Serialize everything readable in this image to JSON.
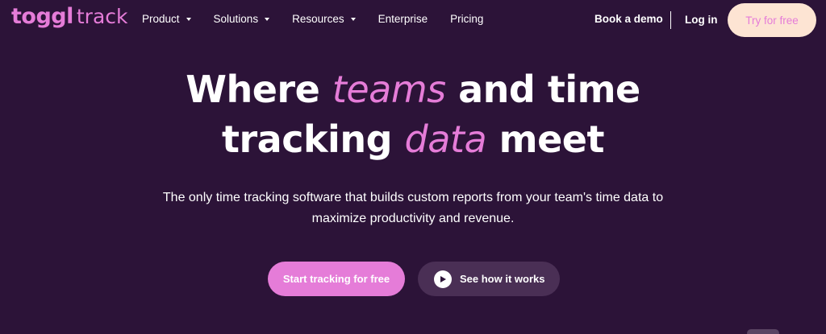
{
  "header": {
    "logo": {
      "word1": "toggl",
      "word2": "track"
    },
    "nav": [
      {
        "label": "Product",
        "has_dropdown": true
      },
      {
        "label": "Solutions",
        "has_dropdown": true
      },
      {
        "label": "Resources",
        "has_dropdown": true
      },
      {
        "label": "Enterprise",
        "has_dropdown": false
      },
      {
        "label": "Pricing",
        "has_dropdown": false
      }
    ],
    "book_demo": "Book a demo",
    "login": "Log in",
    "try_free": "Try for free"
  },
  "hero": {
    "title_part1": "Where ",
    "title_accent1": "teams",
    "title_part2": " and time",
    "title_part3": "tracking ",
    "title_accent2": "data",
    "title_part4": " meet",
    "subtitle": "The only time tracking software that builds custom reports from your team's time data to maximize productivity and revenue.",
    "cta_primary": "Start tracking for free",
    "cta_secondary": "See how it works"
  },
  "icons": {
    "nav_dropdown": "chevron-down-icon",
    "video": "play-icon"
  },
  "colors": {
    "background": "#2c1338",
    "accent": "#e57cd8",
    "try_button_bg": "#fde4d3",
    "secondary_button_bg": "#4a2f55"
  }
}
